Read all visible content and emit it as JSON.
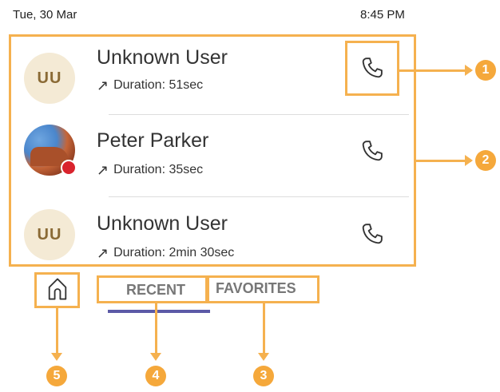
{
  "status": {
    "date": "Tue, 30 Mar",
    "time": "8:45 PM"
  },
  "calls": [
    {
      "name": "Unknown User",
      "initials": "UU",
      "duration": "Duration: 51sec",
      "avatar": "initials"
    },
    {
      "name": "Peter Parker",
      "initials": "",
      "duration": "Duration: 35sec",
      "avatar": "photo",
      "presence": "busy"
    },
    {
      "name": "Unknown User",
      "initials": "UU",
      "duration": "Duration: 2min 30sec",
      "avatar": "initials"
    }
  ],
  "tabs": {
    "recent": "RECENT",
    "favorites": "FAVORITES",
    "active": "recent"
  },
  "callouts": [
    "1",
    "2",
    "3",
    "4",
    "5"
  ],
  "icons": {
    "call": "phone-icon",
    "home": "home-icon",
    "outgoing": "outgoing-arrow-icon"
  },
  "colors": {
    "highlight": "#f5b14f",
    "callout": "#f5a83b",
    "tab_underline": "#5c5aa7",
    "presence_busy": "#d9232d"
  }
}
